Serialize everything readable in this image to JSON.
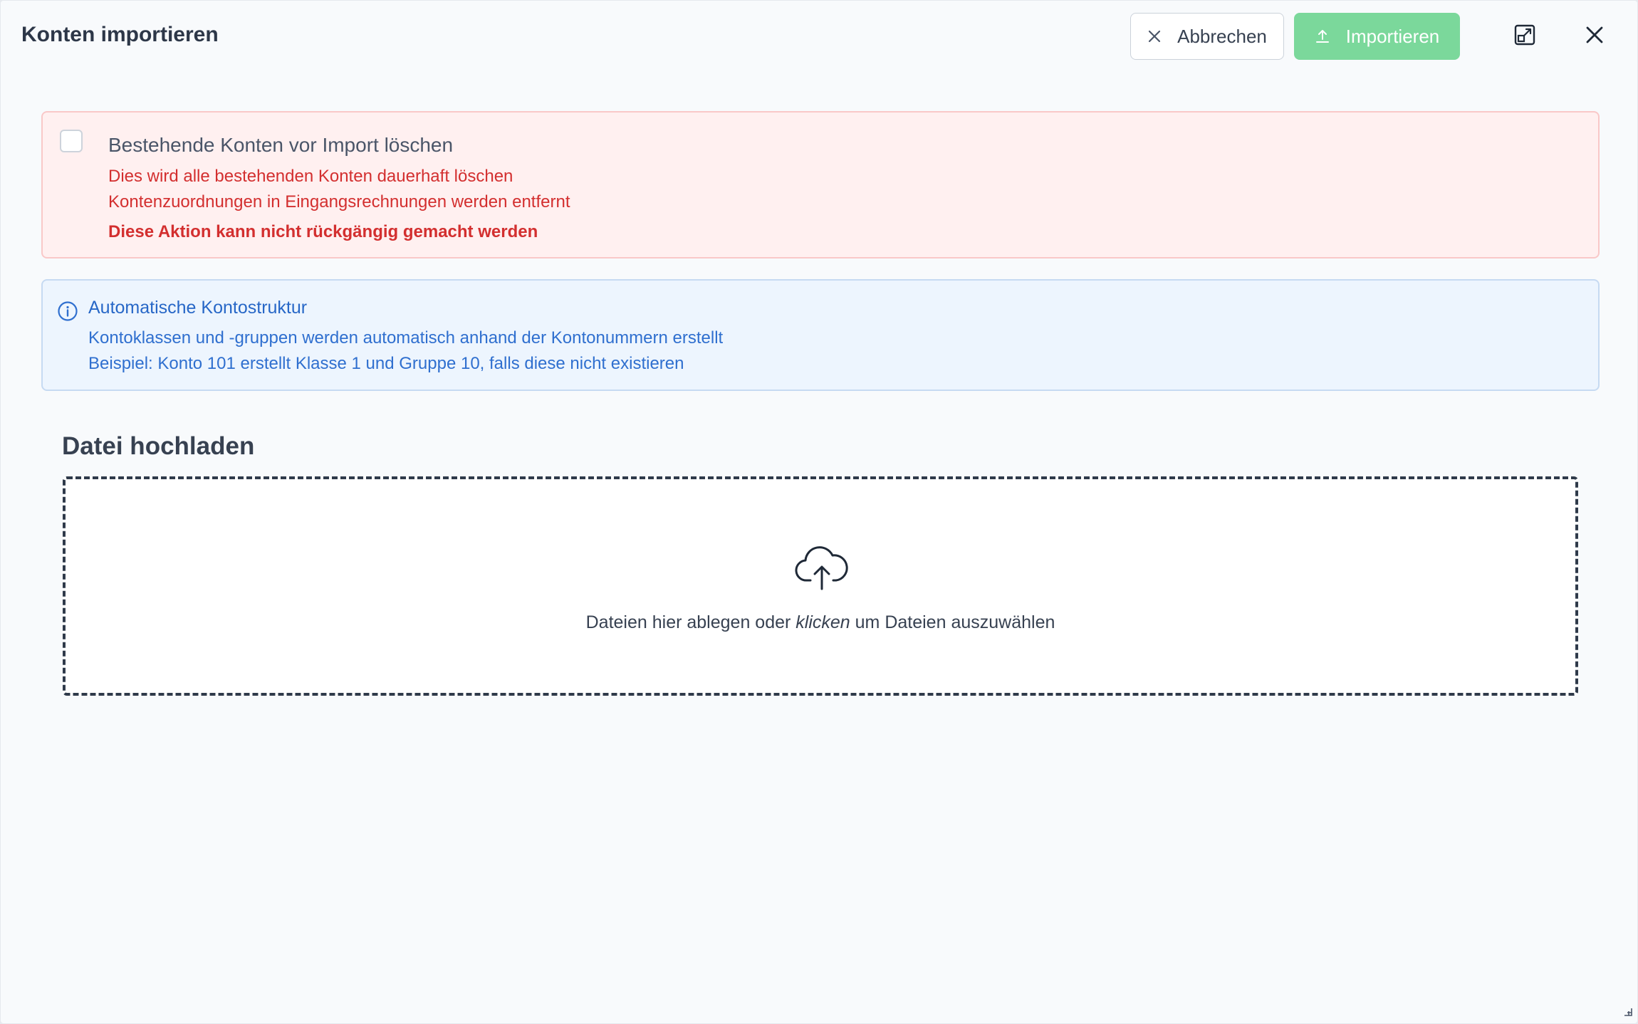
{
  "dialog": {
    "title": "Konten importieren",
    "cancel_label": "Abbrechen",
    "import_label": "Importieren"
  },
  "danger_panel": {
    "checkbox_label": "Bestehende Konten vor Import löschen",
    "line1": "Dies wird alle bestehenden Konten dauerhaft löschen",
    "line2": "Kontenzuordnungen in Eingangsrechnungen werden entfernt",
    "line3": "Diese Aktion kann nicht rückgängig gemacht werden",
    "checked": false
  },
  "info_panel": {
    "title": "Automatische Kontostruktur",
    "line1": "Kontoklassen und -gruppen werden automatisch anhand der Kontonummern erstellt",
    "line2": "Beispiel: Konto 101 erstellt Klasse 1 und Gruppe 10, falls diese nicht existieren"
  },
  "upload": {
    "section_title": "Datei hochladen",
    "text_before": "Dateien hier ablegen oder ",
    "text_emphasis": "klicken",
    "text_after": " um Dateien auszuwählen"
  },
  "icons": {
    "cancel": "close-icon",
    "import": "upload-icon",
    "maximize": "expand-icon",
    "close": "close-icon",
    "info": "info-icon",
    "dropzone": "cloud-upload-icon"
  },
  "colors": {
    "danger_text": "#d32f2f",
    "info_text": "#2f6fcf",
    "import_button": "#7bd89b"
  }
}
